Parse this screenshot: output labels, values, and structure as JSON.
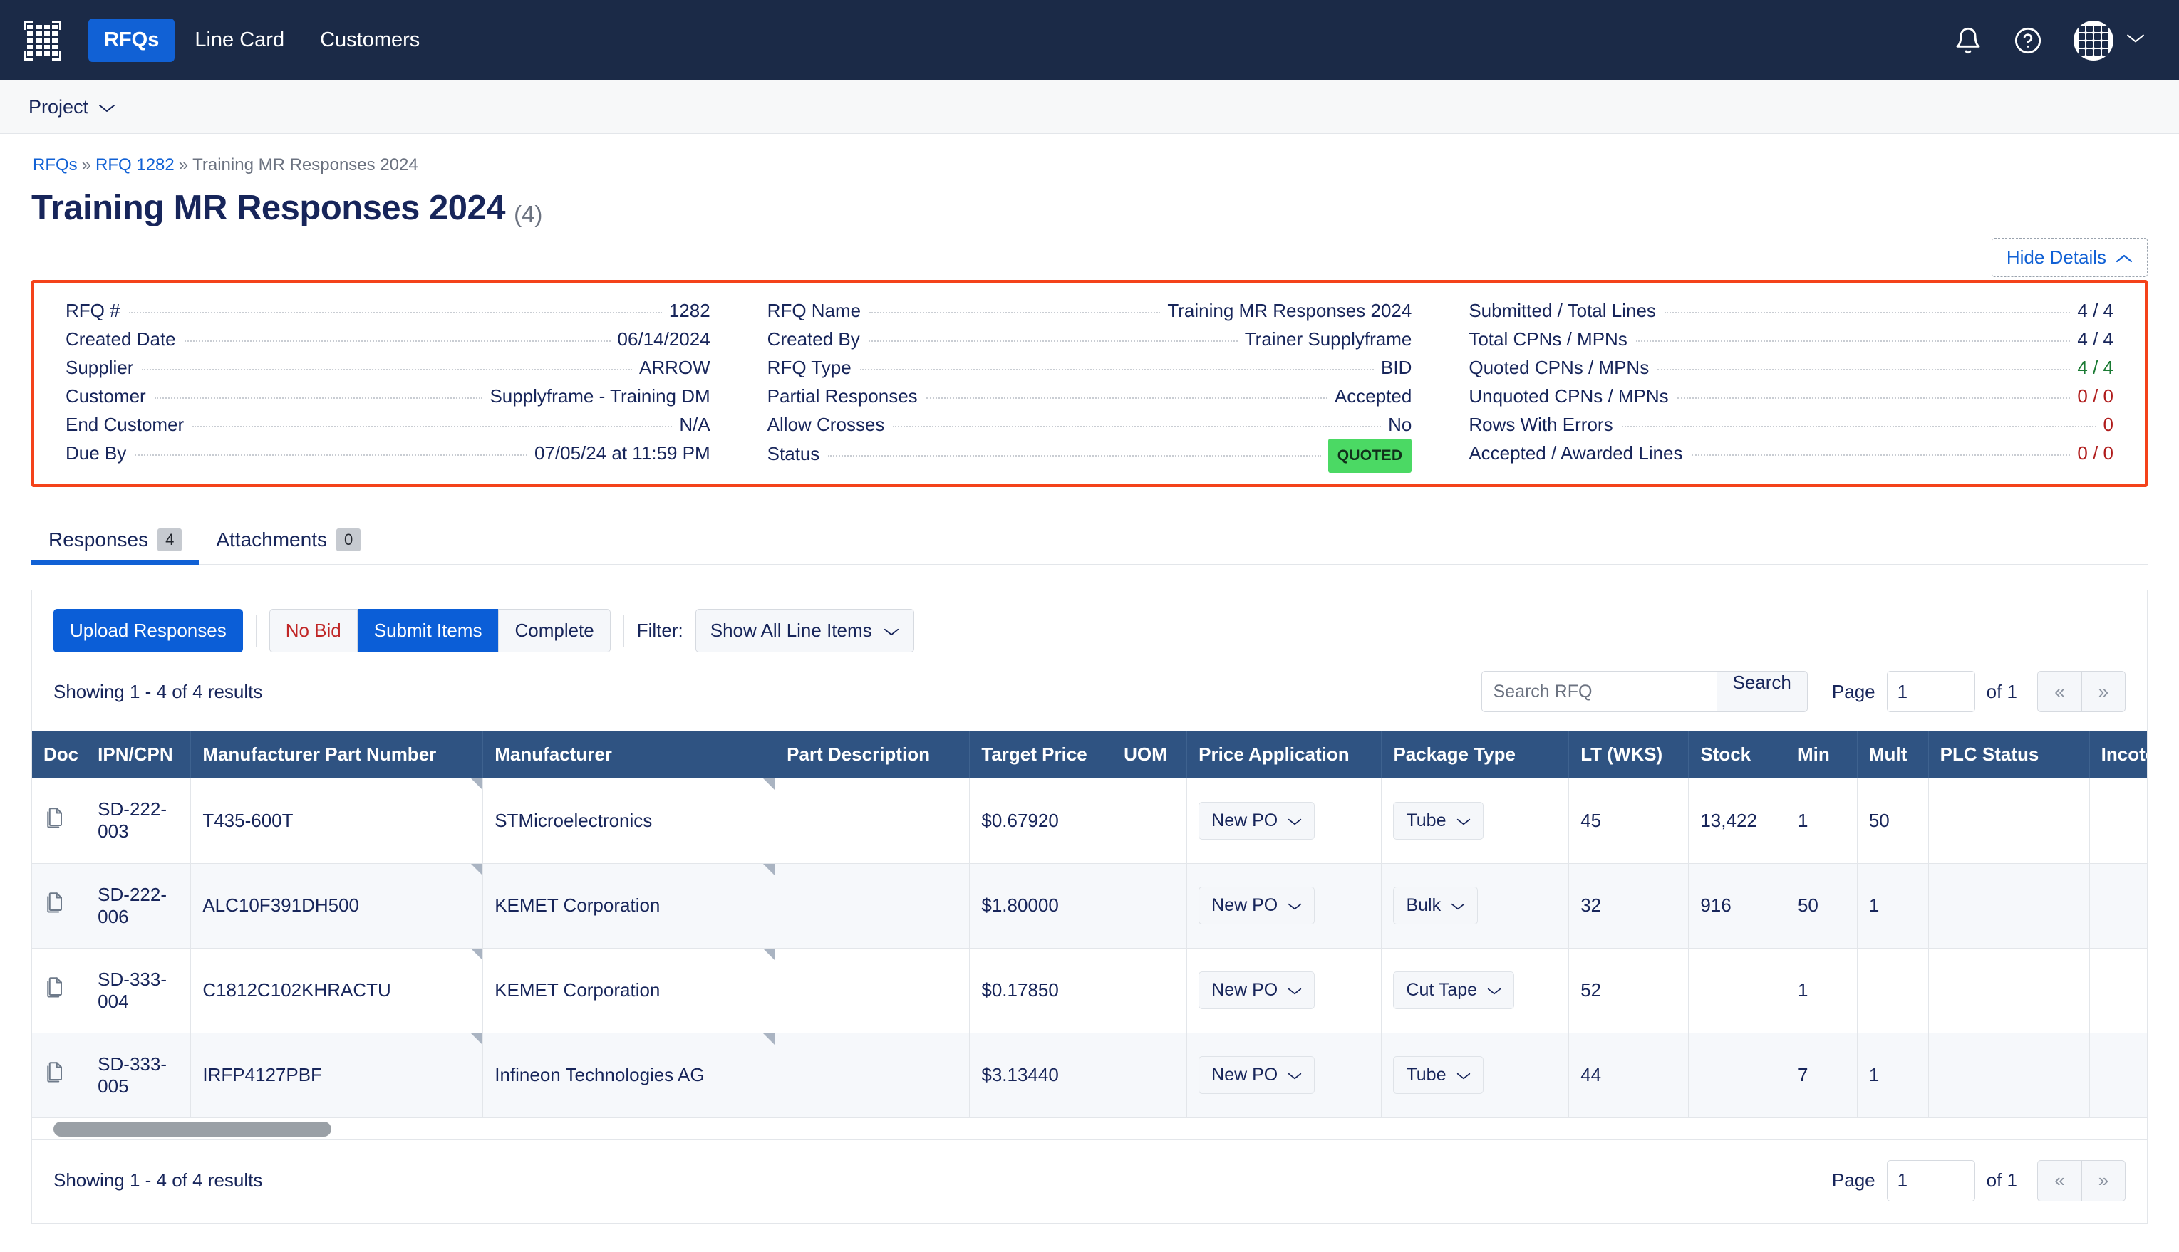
{
  "nav": {
    "logo": "grid-logo-icon",
    "items": [
      {
        "label": "RFQs",
        "active": true
      },
      {
        "label": "Line Card",
        "active": false
      },
      {
        "label": "Customers",
        "active": false
      }
    ],
    "bell": "bell-icon",
    "help": "help-circle-icon",
    "avatar": "avatar-grid-icon",
    "avatar_caret": "chevron-down-icon"
  },
  "project_bar": {
    "label": "Project",
    "caret": "chevron-down-icon"
  },
  "breadcrumb": {
    "root": "RFQs",
    "sep": "»",
    "parent": "RFQ 1282",
    "current": "Training MR Responses 2024"
  },
  "header": {
    "title": "Training MR Responses 2024",
    "count": "(4)",
    "hide_details": "Hide Details",
    "hide_details_caret": "chevron-up-icon"
  },
  "details": {
    "border_color": "#f4421a",
    "col1": [
      {
        "label": "RFQ #",
        "value": "1282"
      },
      {
        "label": "Created Date",
        "value": "06/14/2024"
      },
      {
        "label": "Supplier",
        "value": "ARROW"
      },
      {
        "label": "Customer",
        "value": "Supplyframe - Training DM"
      },
      {
        "label": "End Customer",
        "value": "N/A"
      },
      {
        "label": "Due By",
        "value": "07/05/24 at 11:59 PM"
      }
    ],
    "col2": [
      {
        "label": "RFQ Name",
        "value": "Training MR Responses 2024"
      },
      {
        "label": "Created By",
        "value": "Trainer Supplyframe"
      },
      {
        "label": "RFQ Type",
        "value": "BID"
      },
      {
        "label": "Partial Responses",
        "value": "Accepted"
      },
      {
        "label": "Allow Crosses",
        "value": "No"
      },
      {
        "label": "Status",
        "value": "QUOTED",
        "badge": true,
        "badge_color": "#4bd964"
      }
    ],
    "col3": [
      {
        "label": "Submitted / Total Lines",
        "value": "4 / 4",
        "tone": ""
      },
      {
        "label": "Total CPNs / MPNs",
        "value": "4 / 4",
        "tone": ""
      },
      {
        "label": "Quoted CPNs / MPNs",
        "value": "4 / 4",
        "tone": "green"
      },
      {
        "label": "Unquoted CPNs / MPNs",
        "value": "0 / 0",
        "tone": "red"
      },
      {
        "label": "Rows With Errors",
        "value": "0",
        "tone": "red"
      },
      {
        "label": "Accepted / Awarded Lines",
        "value": "0 / 0",
        "tone": "red"
      }
    ]
  },
  "tabs": [
    {
      "label": "Responses",
      "badge": "4",
      "active": true
    },
    {
      "label": "Attachments",
      "badge": "0",
      "active": false
    }
  ],
  "toolbar": {
    "upload": "Upload Responses",
    "no_bid": "No Bid",
    "submit_items": "Submit Items",
    "complete": "Complete",
    "filter_label": "Filter:",
    "filter_value": "Show All Line Items",
    "filter_caret": "chevron-down-icon"
  },
  "results": {
    "top_text": "Showing 1 - 4 of 4 results",
    "bottom_text": "Showing 1 - 4 of 4 results",
    "search_placeholder": "Search RFQ",
    "search_value": "",
    "search_button": "Search",
    "page_label": "Page",
    "page_value": "1",
    "page_of": "of 1",
    "prev_icon": "«",
    "next_icon": "»"
  },
  "table": {
    "columns": [
      "Doc",
      "IPN/CPN",
      "Manufacturer Part Number",
      "Manufacturer",
      "Part Description",
      "Target Price",
      "UOM",
      "Price Application",
      "Package Type",
      "LT (WKS)",
      "Stock",
      "Min",
      "Mult",
      "PLC Status",
      "Incoterms"
    ],
    "rows": [
      {
        "doc": "copy-document-icon",
        "ipn_cpn": "SD-222-003",
        "mpn": "T435-600T",
        "manufacturer": "STMicroelectronics",
        "part_description": "",
        "target_price": "$0.67920",
        "uom": "",
        "price_application": "New PO",
        "package_type": "Tube",
        "lt_wks": "45",
        "stock": "13,422",
        "min": "1",
        "mult": "50",
        "plc_status": "",
        "incoterms": ""
      },
      {
        "doc": "copy-document-icon",
        "ipn_cpn": "SD-222-006",
        "mpn": "ALC10F391DH500",
        "manufacturer": "KEMET Corporation",
        "part_description": "",
        "target_price": "$1.80000",
        "uom": "",
        "price_application": "New PO",
        "package_type": "Bulk",
        "lt_wks": "32",
        "stock": "916",
        "min": "50",
        "mult": "1",
        "plc_status": "",
        "incoterms": ""
      },
      {
        "doc": "copy-document-icon",
        "ipn_cpn": "SD-333-004",
        "mpn": "C1812C102KHRACTU",
        "manufacturer": "KEMET Corporation",
        "part_description": "",
        "target_price": "$0.17850",
        "uom": "",
        "price_application": "New PO",
        "package_type": "Cut Tape",
        "lt_wks": "52",
        "stock": "",
        "min": "1",
        "mult": "",
        "plc_status": "",
        "incoterms": ""
      },
      {
        "doc": "copy-document-icon",
        "ipn_cpn": "SD-333-005",
        "mpn": "IRFP4127PBF",
        "manufacturer": "Infineon Technologies AG",
        "part_description": "",
        "target_price": "$3.13440",
        "uom": "",
        "price_application": "New PO",
        "package_type": "Tube",
        "lt_wks": "44",
        "stock": "",
        "min": "7",
        "mult": "1",
        "plc_status": "",
        "incoterms": ""
      }
    ]
  },
  "colors": {
    "nav_bg": "#1b2a47",
    "accent_blue": "#1161d5",
    "table_header": "#2f5382",
    "alert_border": "#f4421a",
    "status_green": "#4bd964"
  }
}
